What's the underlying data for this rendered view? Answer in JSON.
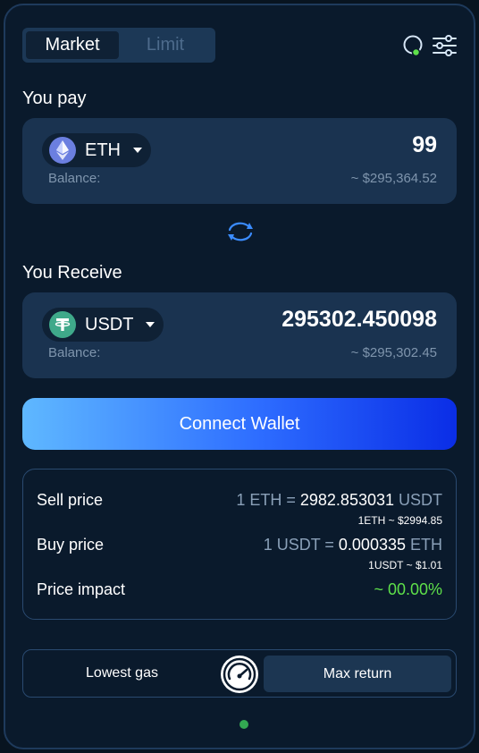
{
  "tabs": {
    "market": "Market",
    "limit": "Limit",
    "active": "Market"
  },
  "header_icons": {
    "status": "status-ring-icon",
    "settings": "sliders-icon",
    "status_color": "#5ee04a"
  },
  "pay": {
    "label": "You pay",
    "token": "ETH",
    "token_icon": "ethereum-icon",
    "amount": "99",
    "balance_label": "Balance:",
    "usd_value": "~ $295,364.52"
  },
  "swap_icon": "swap-arrows-icon",
  "receive": {
    "label": "You Receive",
    "token": "USDT",
    "token_icon": "tether-icon",
    "amount": "295302.450098",
    "balance_label": "Balance:",
    "usd_value": "~ $295,302.45"
  },
  "connect_button": "Connect Wallet",
  "info": {
    "sell": {
      "label": "Sell price",
      "prefix": "1 ETH = ",
      "value": "2982.853031",
      "unit": " USDT",
      "sub": "1ETH ~ $2994.85"
    },
    "buy": {
      "label": "Buy price",
      "prefix": "1 USDT = ",
      "value": "0.000335",
      "unit": " ETH",
      "sub": "1USDT ~ $1.01"
    },
    "impact": {
      "label": "Price impact",
      "value": "~ 00.00%"
    }
  },
  "route": {
    "lowest_gas": "Lowest gas",
    "max_return": "Max return",
    "selected": "Max return"
  },
  "colors": {
    "accent": "#2d6cff",
    "green": "#5ee04a",
    "background": "#081420"
  }
}
